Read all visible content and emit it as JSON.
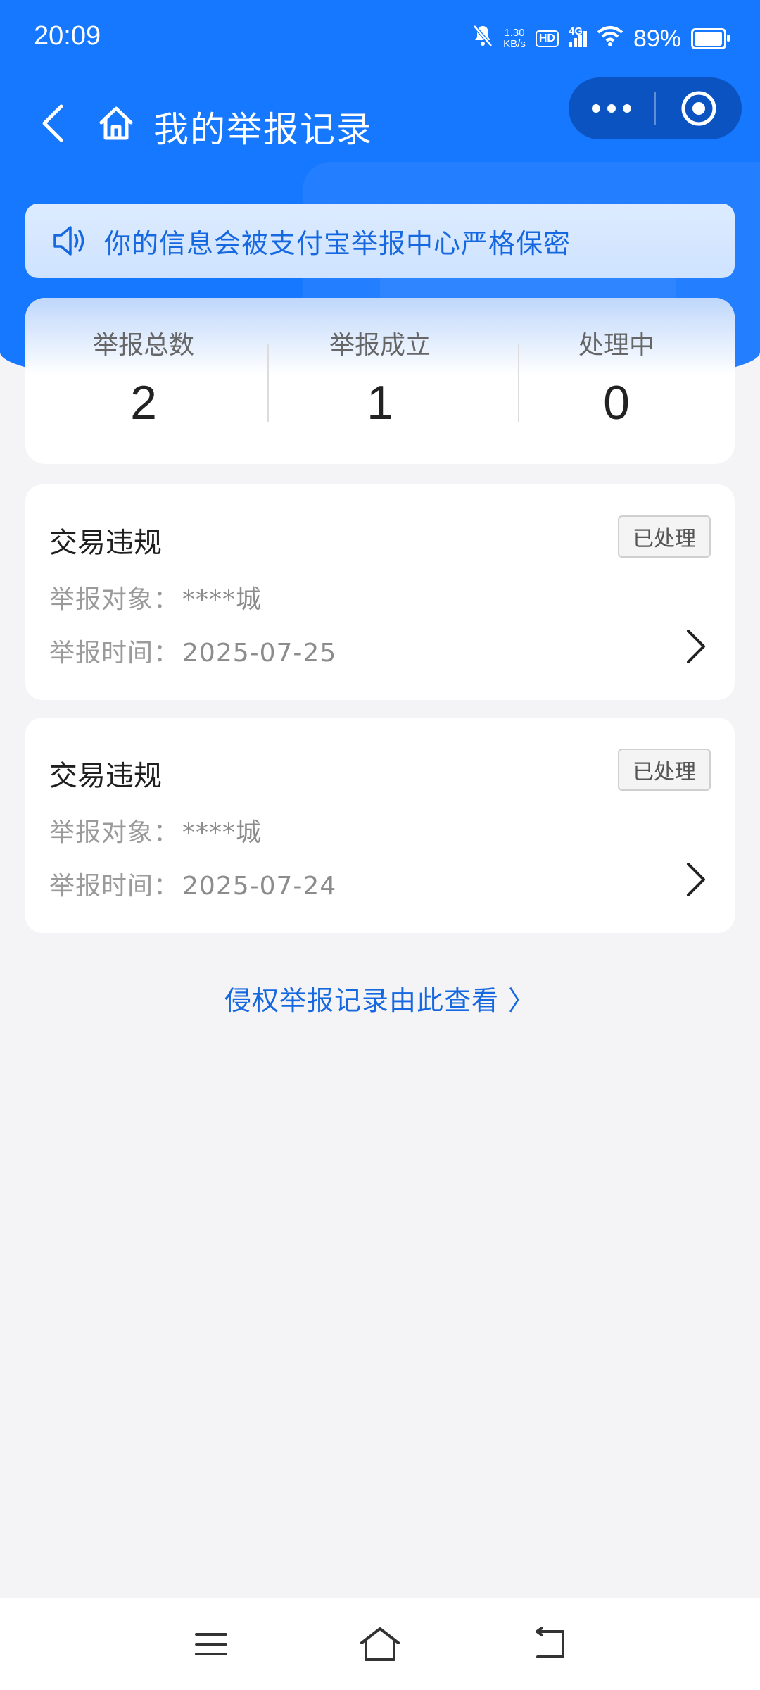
{
  "status_bar": {
    "time": "20:09",
    "net_speed_value": "1.30",
    "net_speed_unit": "KB/s",
    "hd": "HD",
    "network": "4G",
    "battery": "89%",
    "battery_level": 0.89
  },
  "nav": {
    "title": "我的举报记录"
  },
  "notice": {
    "text": "你的信息会被支付宝举报中心严格保密"
  },
  "stats": [
    {
      "label": "举报总数",
      "value": "2"
    },
    {
      "label": "举报成立",
      "value": "1"
    },
    {
      "label": "处理中",
      "value": "0"
    }
  ],
  "records": [
    {
      "type": "交易违规",
      "status": "已处理",
      "target_label": "举报对象：",
      "target": "****城",
      "time_label": "举报时间：",
      "time": "2025-07-25"
    },
    {
      "type": "交易违规",
      "status": "已处理",
      "target_label": "举报对象：",
      "target": "****城",
      "time_label": "举报时间：",
      "time": "2025-07-24"
    }
  ],
  "link": {
    "text": "侵权举报记录由此查看 〉"
  },
  "colors": {
    "brand": "#1677ff",
    "link": "#1668e0",
    "background": "#f4f4f6"
  }
}
